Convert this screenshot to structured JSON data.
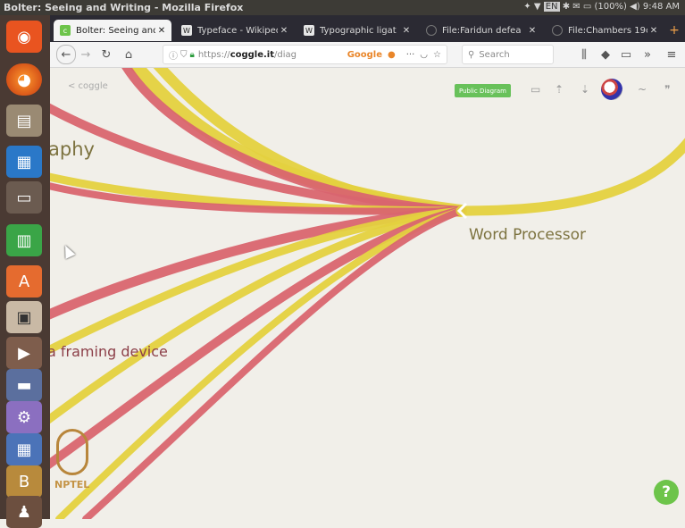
{
  "window": {
    "title": "Bolter: Seeing and Writing - Mozilla Firefox"
  },
  "tray": {
    "battery": "(100%)",
    "time": "9:48 AM",
    "keyboard": "EN"
  },
  "launcher": {
    "items": [
      "dash-icon",
      "firefox-icon",
      "files-icon",
      "writer-icon",
      "impress-icon",
      "calc-icon",
      "software-center-icon",
      "document-viewer-icon",
      "media-player-icon",
      "terminal-icon",
      "settings-icon",
      "workspace-icon",
      "books-icon",
      "game-icon"
    ]
  },
  "tabs": [
    {
      "label": "Bolter: Seeing and",
      "active": true,
      "favicon": "c"
    },
    {
      "label": "Typeface - Wikiped",
      "active": false,
      "favicon": "W"
    },
    {
      "label": "Typographic ligat",
      "active": false,
      "favicon": "W"
    },
    {
      "label": "File:Faridun defea",
      "active": false,
      "favicon": ""
    },
    {
      "label": "File:Chambers 19c",
      "active": false,
      "favicon": ""
    }
  ],
  "toolbar": {
    "url_prefix": "https://",
    "url_domain": "coggle.it",
    "url_path": "/diag",
    "google_label": "Google",
    "search_placeholder": "Search",
    "more_label": "···"
  },
  "coggle": {
    "back_label": "< coggle",
    "public_badge": "Public Diagram",
    "nodes": {
      "typography": "aphy",
      "word_processor": "Word Processor",
      "framing": "a framing device"
    },
    "branch_colors": {
      "red": "#d9656f",
      "yellow": "#e4d13f"
    },
    "help_label": "?"
  },
  "watermark": {
    "text": "NPTEL"
  }
}
